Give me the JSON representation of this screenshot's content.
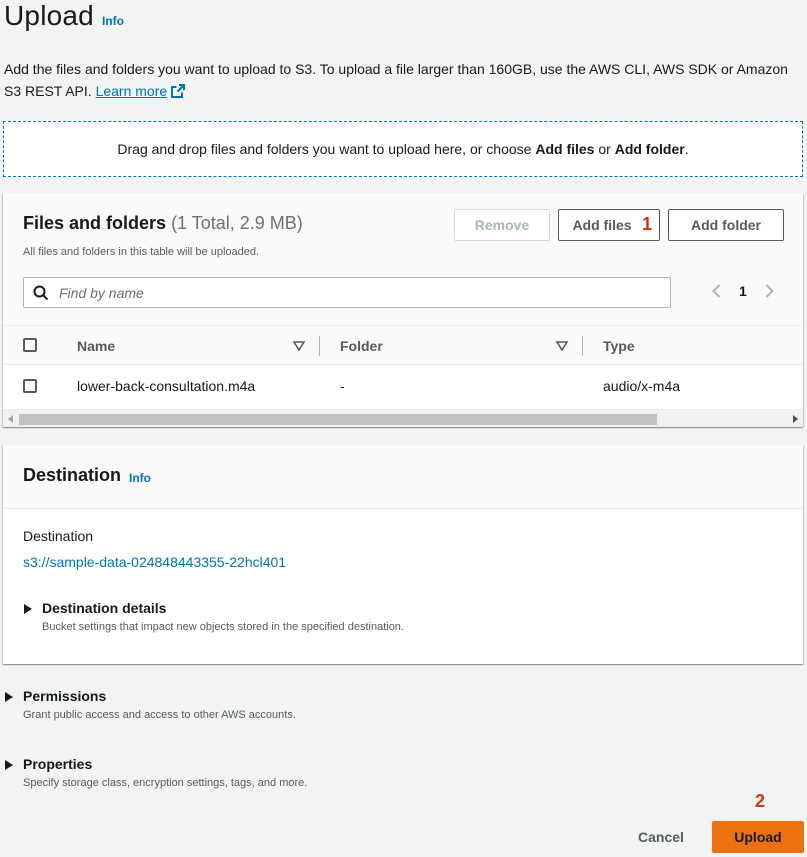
{
  "header": {
    "title": "Upload",
    "info_label": "Info",
    "description": "Add the files and folders you want to upload to S3. To upload a file larger than 160GB, use the AWS CLI, AWS SDK or Amazon S3 REST API.",
    "learn_more": "Learn more"
  },
  "dropzone": {
    "text_prefix": "Drag and drop files and folders you want to upload here, or choose",
    "add_files": "Add files",
    "or": "or",
    "add_folder": "Add folder",
    "suffix": "."
  },
  "files": {
    "title": "Files and folders",
    "count": "(1 Total, 2.9 MB)",
    "subtitle": "All files and folders in this table will be uploaded.",
    "remove_label": "Remove",
    "add_files_label": "Add files",
    "add_folder_label": "Add folder",
    "search_placeholder": "Find by name",
    "page_number": "1",
    "columns": [
      "Name",
      "Folder",
      "Type"
    ],
    "rows": [
      {
        "name": "lower-back-consultation.m4a",
        "folder": "-",
        "type": "audio/x-m4a"
      }
    ]
  },
  "destination": {
    "title": "Destination",
    "info_label": "Info",
    "label": "Destination",
    "path": "s3://sample-data-024848443355-22hcl401",
    "details_title": "Destination details",
    "details_sub": "Bucket settings that impact new objects stored in the specified destination."
  },
  "permissions": {
    "title": "Permissions",
    "sub": "Grant public access and access to other AWS accounts."
  },
  "properties": {
    "title": "Properties",
    "sub": "Specify storage class, encryption settings, tags, and more."
  },
  "footer": {
    "cancel_label": "Cancel",
    "upload_label": "Upload"
  },
  "markers": {
    "one": "1",
    "two": "2"
  },
  "colors": {
    "link": "#0073bb",
    "primary_button": "#ec7211",
    "marker": "#d13212"
  },
  "icons": [
    "external-link-icon",
    "search-icon",
    "chevron-left-icon",
    "chevron-right-icon",
    "sort-icon",
    "caret-right-icon",
    "scroll-left-icon",
    "scroll-right-icon"
  ]
}
